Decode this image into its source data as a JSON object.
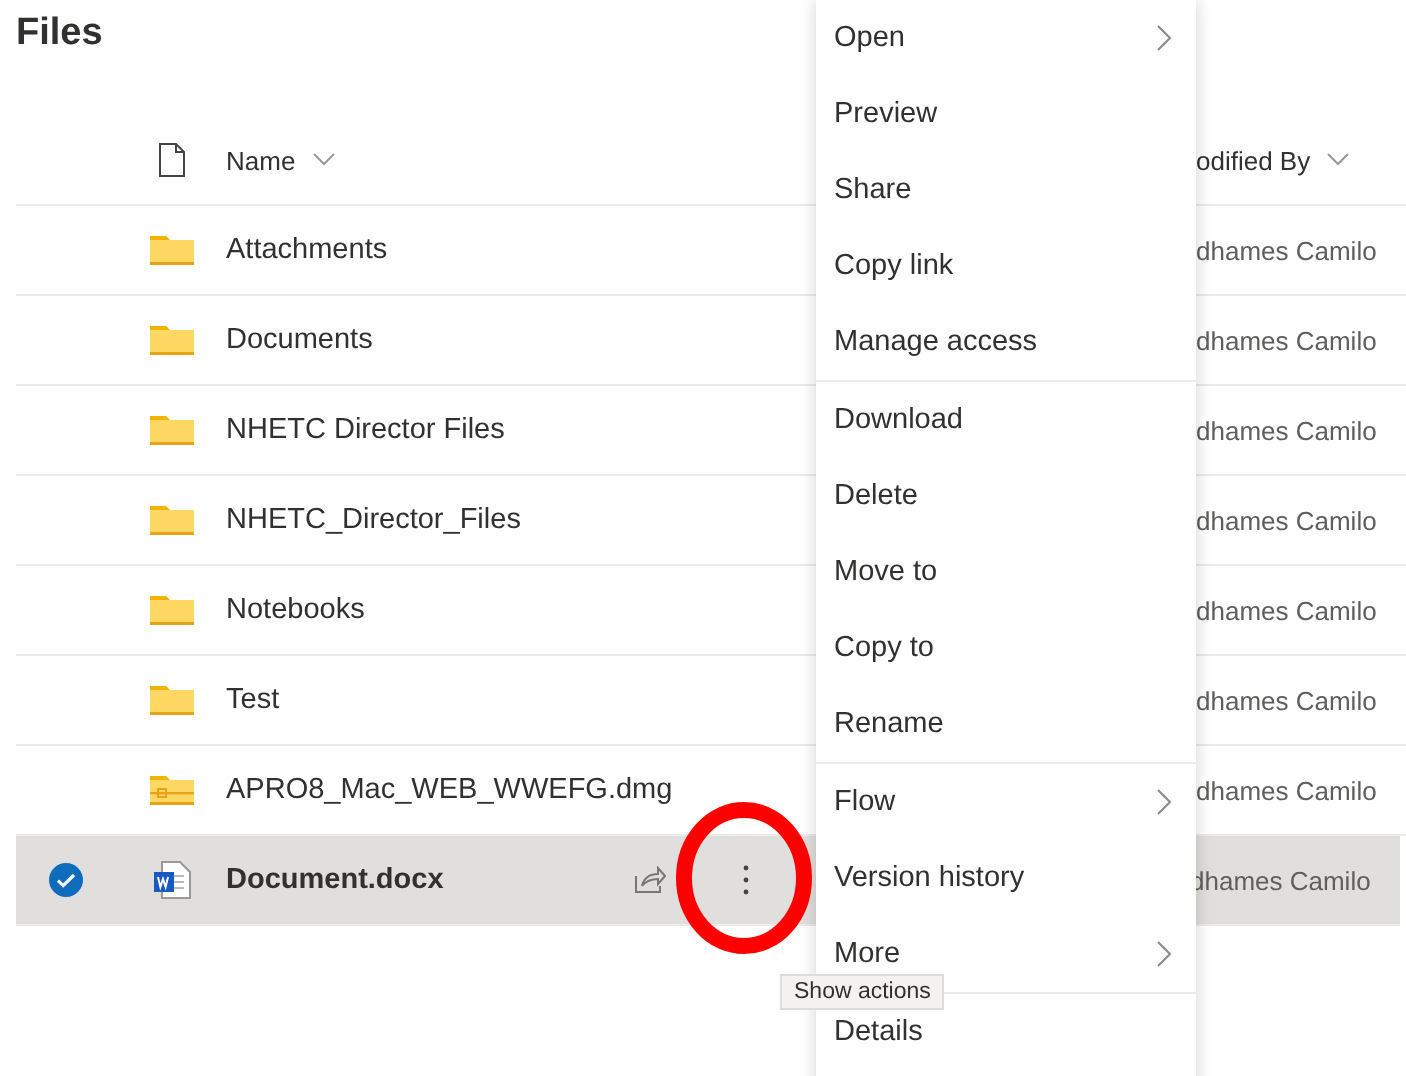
{
  "title": "Files",
  "columns": {
    "name": "Name",
    "modified_by": "odified By"
  },
  "rows": [
    {
      "name": "Attachments",
      "kind": "folder",
      "modified_by": "dhames Camilo",
      "selected": false
    },
    {
      "name": "Documents",
      "kind": "folder",
      "modified_by": "dhames Camilo",
      "selected": false
    },
    {
      "name": "NHETC Director Files",
      "kind": "folder",
      "modified_by": "dhames Camilo",
      "selected": false
    },
    {
      "name": "NHETC_Director_Files",
      "kind": "folder",
      "modified_by": "dhames Camilo",
      "selected": false
    },
    {
      "name": "Notebooks",
      "kind": "folder",
      "modified_by": "dhames Camilo",
      "selected": false
    },
    {
      "name": "Test",
      "kind": "folder",
      "modified_by": "dhames Camilo",
      "selected": false
    },
    {
      "name": "APRO8_Mac_WEB_WWEFG.dmg",
      "kind": "archive",
      "modified_by": "dhames Camilo",
      "selected": false
    },
    {
      "name": "Document.docx",
      "kind": "word",
      "modified_by": "dhames Camilo",
      "selected": true
    }
  ],
  "menu": {
    "groups": [
      [
        {
          "label": "Open",
          "submenu": true
        },
        {
          "label": "Preview",
          "submenu": false
        },
        {
          "label": "Share",
          "submenu": false
        },
        {
          "label": "Copy link",
          "submenu": false
        },
        {
          "label": "Manage access",
          "submenu": false
        }
      ],
      [
        {
          "label": "Download",
          "submenu": false
        },
        {
          "label": "Delete",
          "submenu": false
        },
        {
          "label": "Move to",
          "submenu": false
        },
        {
          "label": "Copy to",
          "submenu": false
        },
        {
          "label": "Rename",
          "submenu": false
        }
      ],
      [
        {
          "label": "Flow",
          "submenu": true
        },
        {
          "label": "Version history",
          "submenu": false
        },
        {
          "label": "More",
          "submenu": true
        }
      ],
      [
        {
          "label": "Details",
          "submenu": false
        }
      ]
    ]
  },
  "tooltip": {
    "text": "Show actions"
  }
}
